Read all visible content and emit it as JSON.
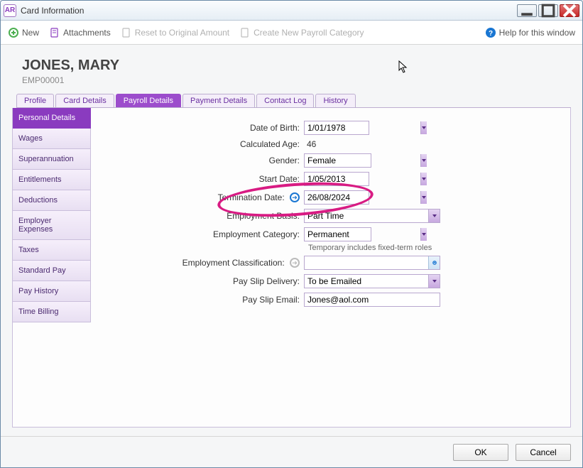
{
  "window": {
    "title": "Card Information"
  },
  "toolbar": {
    "new": "New",
    "attachments": "Attachments",
    "reset": "Reset to Original Amount",
    "create_category": "Create New Payroll Category",
    "help": "Help for this window"
  },
  "header": {
    "name": "JONES, MARY",
    "id": "EMP00001"
  },
  "tabs": [
    "Profile",
    "Card Details",
    "Payroll Details",
    "Payment Details",
    "Contact Log",
    "History"
  ],
  "active_tab": "Payroll Details",
  "sidebar": [
    "Personal Details",
    "Wages",
    "Superannuation",
    "Entitlements",
    "Deductions",
    "Employer Expenses",
    "Taxes",
    "Standard Pay",
    "Pay History",
    "Time Billing"
  ],
  "active_side": "Personal Details",
  "form": {
    "dob_label": "Date of Birth:",
    "dob_value": "1/01/1978",
    "age_label": "Calculated Age:",
    "age_value": "46",
    "gender_label": "Gender:",
    "gender_value": "Female",
    "start_label": "Start Date:",
    "start_value": "1/05/2013",
    "term_label": "Termination Date:",
    "term_value": "26/08/2024",
    "basis_label": "Employment Basis:",
    "basis_value": "Part Time",
    "cat_label": "Employment Category:",
    "cat_value": "Permanent",
    "cat_note": "Temporary includes fixed-term roles",
    "class_label": "Employment Classification:",
    "class_value": "",
    "slip_delivery_label": "Pay Slip Delivery:",
    "slip_delivery_value": "To be Emailed",
    "slip_email_label": "Pay Slip Email:",
    "slip_email_value": "Jones@aol.com"
  },
  "footer": {
    "ok": "OK",
    "cancel": "Cancel"
  }
}
